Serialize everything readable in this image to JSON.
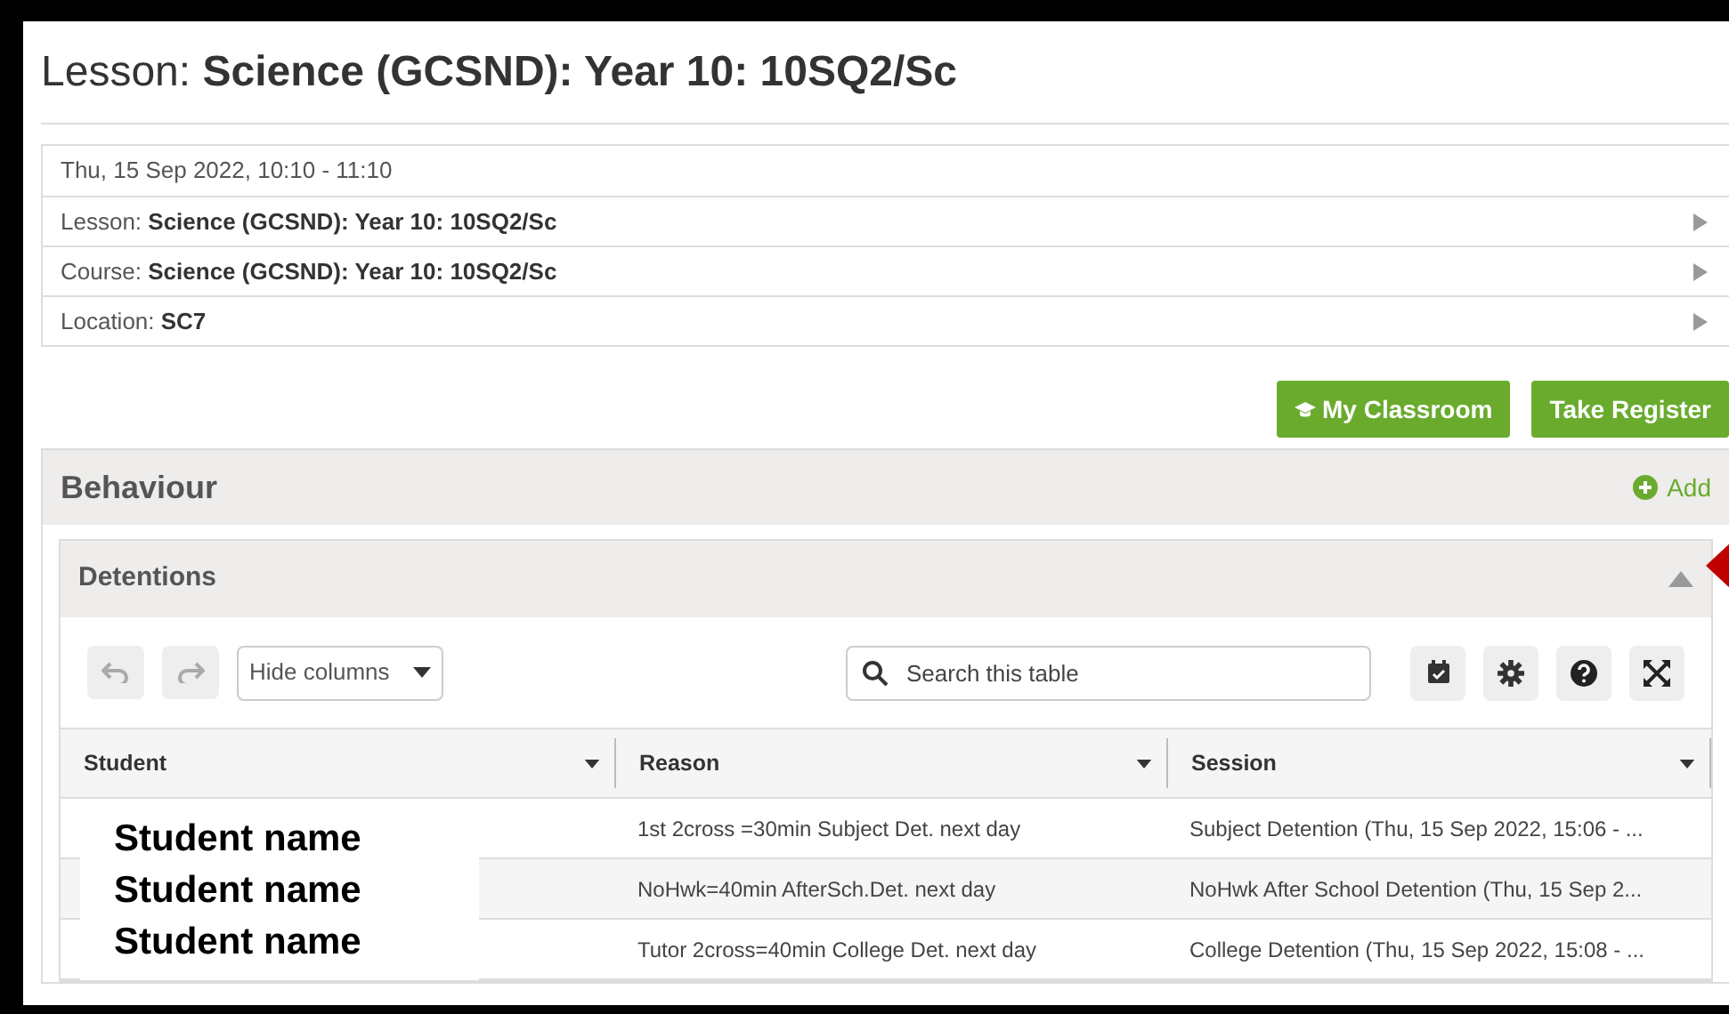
{
  "page_title": {
    "prefix": "Lesson:",
    "name": "Science (GCSND): Year 10: 10SQ2/Sc"
  },
  "details": [
    {
      "value": "Thu, 15 Sep 2022, 10:10 - 11:10"
    },
    {
      "label": "Lesson:",
      "value": "Science (GCSND): Year 10: 10SQ2/Sc",
      "expandable": true
    },
    {
      "label": "Course:",
      "value": "Science (GCSND): Year 10: 10SQ2/Sc",
      "expandable": true
    },
    {
      "label": "Location:",
      "value": "SC7",
      "expandable": true
    }
  ],
  "buttons": [
    {
      "label": "My Classroom",
      "has_icon": true
    },
    {
      "label": "Take Register",
      "has_icon": false
    }
  ],
  "behaviour": {
    "title": "Behaviour",
    "add_label": "Add",
    "detentions": {
      "title": "Detentions",
      "expanded": true,
      "hide_columns": "Hide columns",
      "search_placeholder": "Search this table",
      "columns": [
        "Student",
        "Reason",
        "Session"
      ],
      "rows": [
        {
          "reason": "1st 2cross =30min Subject Det. next day",
          "session": "Subject Detention (Thu, 15 Sep 2022, 15:06 - ..."
        },
        {
          "reason": "NoHwk=40min AfterSch.Det. next day",
          "session": "NoHwk After School Detention (Thu, 15 Sep 2..."
        },
        {
          "reason": "Tutor 2cross=40min College Det. next day",
          "session": "College Detention (Thu, 15 Sep 2022, 15:08 - ..."
        }
      ]
    }
  },
  "overlay": {
    "student_names": [
      "Student name",
      "Student name",
      "Student name"
    ]
  }
}
